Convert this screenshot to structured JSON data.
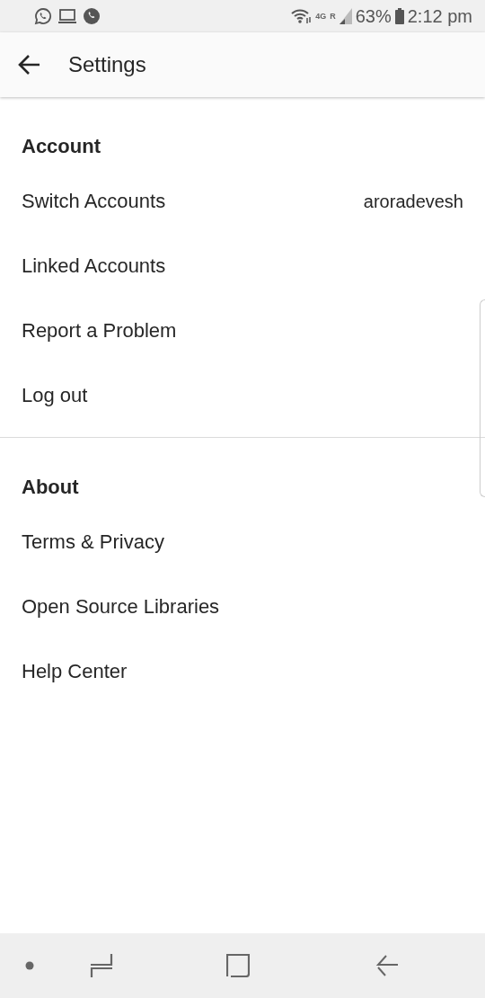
{
  "status_bar": {
    "battery": "63%",
    "time": "2:12 pm",
    "network": "4G",
    "roaming": "R"
  },
  "app_bar": {
    "title": "Settings"
  },
  "sections": [
    {
      "title": "Account",
      "items": [
        {
          "label": "Switch Accounts",
          "value": "aroradevesh"
        },
        {
          "label": "Linked Accounts"
        },
        {
          "label": "Report a Problem"
        },
        {
          "label": "Log out"
        }
      ]
    },
    {
      "title": "About",
      "items": [
        {
          "label": "Terms & Privacy"
        },
        {
          "label": "Open Source Libraries"
        },
        {
          "label": "Help Center"
        }
      ]
    }
  ]
}
